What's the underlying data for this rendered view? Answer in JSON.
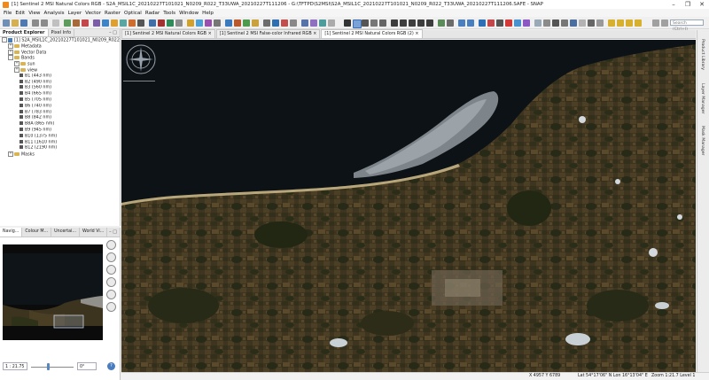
{
  "window": {
    "title": "[1] Sentinel 2 MSI Natural Colors RGB - S2A_MSIL1C_20210227T101021_N0209_R022_T33UWA_20210227T111206 - G:\\TFTPD\\S2MSI\\S2A_MSIL1C_20210227T101021_N0209_R022_T33UWA_20210227T111206.SAFE - SNAP",
    "controls": [
      "–",
      "❐",
      "✕"
    ]
  },
  "menu": [
    "File",
    "Edit",
    "View",
    "Analysis",
    "Layer",
    "Vector",
    "Raster",
    "Optical",
    "Radar",
    "Tools",
    "Window",
    "Help"
  ],
  "toolbar": {
    "search_placeholder": "Search (Ctrl+I)"
  },
  "product_explorer": {
    "tabs": [
      "Product Explorer",
      "Pixel Info"
    ],
    "panel_buttons": "– □",
    "tree": [
      {
        "label": "[1] S2A_MSIL1C_20210227T101021_N0209_R022_T33U",
        "level": 0,
        "kind": "prod",
        "exp": "-"
      },
      {
        "label": "Metadata",
        "level": 1,
        "kind": "fold",
        "exp": "+"
      },
      {
        "label": "Vector Data",
        "level": 1,
        "kind": "fold",
        "exp": "+"
      },
      {
        "label": "Bands",
        "level": 1,
        "kind": "fold",
        "exp": "-"
      },
      {
        "label": "sun",
        "level": 2,
        "kind": "fold",
        "exp": "+"
      },
      {
        "label": "view",
        "level": 2,
        "kind": "fold",
        "exp": "+"
      },
      {
        "label": "B1 (443 nm)",
        "level": 2,
        "kind": "band",
        "exp": ""
      },
      {
        "label": "B2 (490 nm)",
        "level": 2,
        "kind": "band",
        "exp": ""
      },
      {
        "label": "B3 (560 nm)",
        "level": 2,
        "kind": "band",
        "exp": ""
      },
      {
        "label": "B4 (665 nm)",
        "level": 2,
        "kind": "band",
        "exp": ""
      },
      {
        "label": "B5 (705 nm)",
        "level": 2,
        "kind": "band",
        "exp": ""
      },
      {
        "label": "B6 (740 nm)",
        "level": 2,
        "kind": "band",
        "exp": ""
      },
      {
        "label": "B7 (783 nm)",
        "level": 2,
        "kind": "band",
        "exp": ""
      },
      {
        "label": "B8 (842 nm)",
        "level": 2,
        "kind": "band",
        "exp": ""
      },
      {
        "label": "B8A (865 nm)",
        "level": 2,
        "kind": "band",
        "exp": ""
      },
      {
        "label": "B9 (945 nm)",
        "level": 2,
        "kind": "band",
        "exp": ""
      },
      {
        "label": "B10 (1375 nm)",
        "level": 2,
        "kind": "band",
        "exp": ""
      },
      {
        "label": "B11 (1610 nm)",
        "level": 2,
        "kind": "band",
        "exp": ""
      },
      {
        "label": "B12 (2190 nm)",
        "level": 2,
        "kind": "band",
        "exp": ""
      },
      {
        "label": "Masks",
        "level": 1,
        "kind": "fold",
        "exp": "+"
      }
    ]
  },
  "navigation": {
    "tabs": [
      "Navig...",
      "Colour M...",
      "Uncertai...",
      "World Vi..."
    ],
    "panel_buttons": "– □",
    "scale": "1 : 21.75",
    "angle": "0°",
    "help": "?"
  },
  "documents": {
    "tabs": [
      "[1] Sentinel 2 MSI Natural Colors RGB",
      "[1] Sentinel 2 MSI False-color Infrared RGB",
      "[1] Sentinel 2 MSI Natural Colors RGB (2)"
    ],
    "close_glyph": "×"
  },
  "right_sidebar": [
    "Product Library",
    "Layer Manager",
    "Mask Manager"
  ],
  "status": {
    "coords": "X 4957  Y 6789",
    "latlon": "Lat 54°17'06\" N  Lon 16°13'04\" E",
    "zoom": "Zoom 1:21.7  Level 1"
  },
  "colors": {
    "sea": "#0d1216",
    "land": "#3f3520",
    "field": "#5a4a2c",
    "forest": "#2b3018",
    "snow": "#d8dde2",
    "accent": "#f08a1c"
  }
}
